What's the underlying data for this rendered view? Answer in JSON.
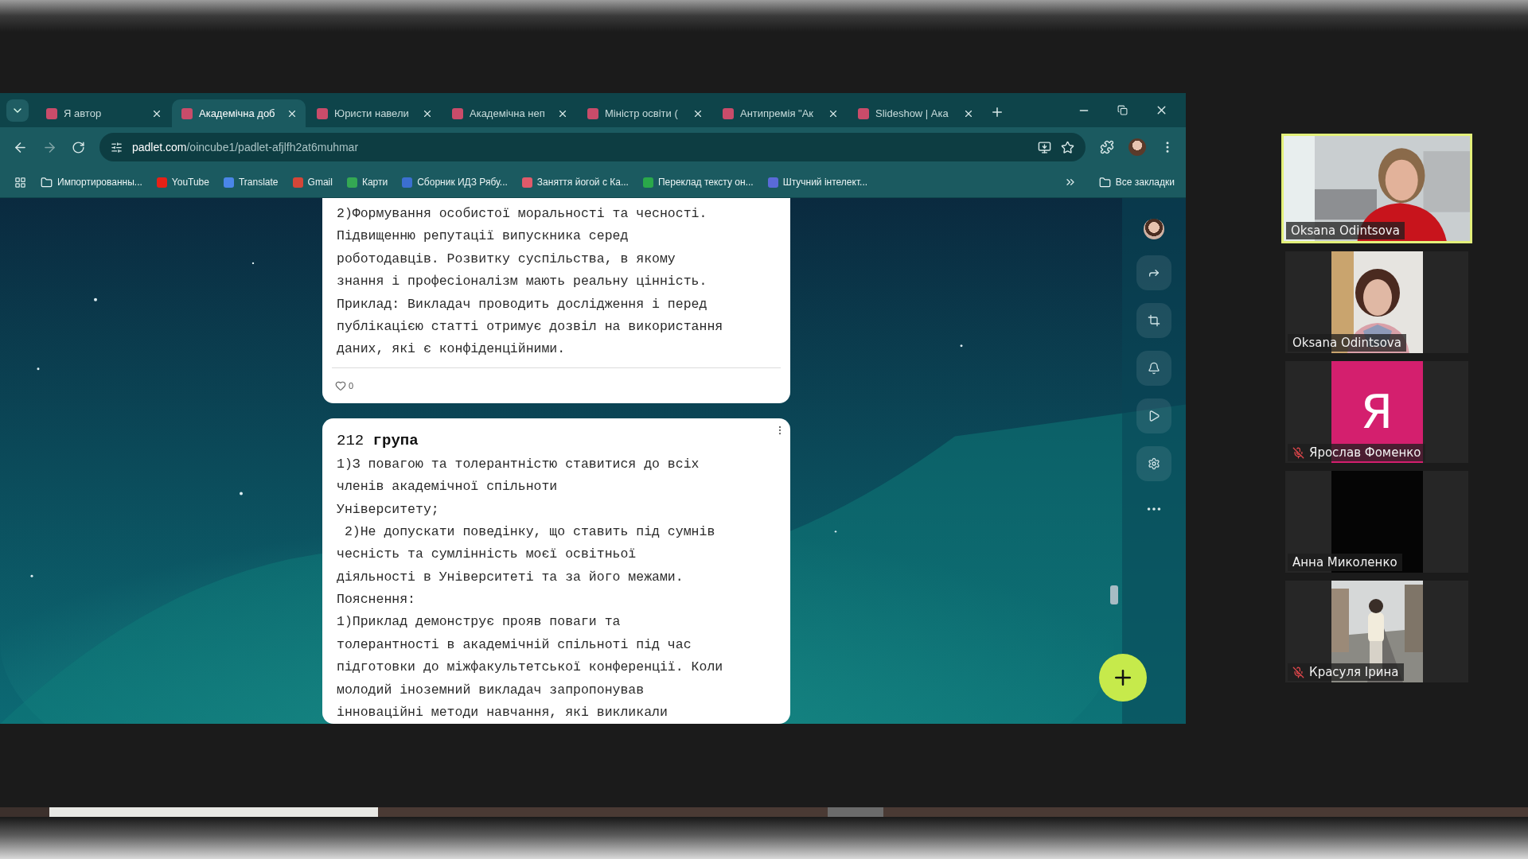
{
  "browser": {
    "tabs": [
      {
        "title": "Я автор",
        "selected": false
      },
      {
        "title": "Академічна доб",
        "selected": true
      },
      {
        "title": "Юристи навели",
        "selected": false
      },
      {
        "title": "Академічна неп",
        "selected": false
      },
      {
        "title": "Міністр освіти (",
        "selected": false
      },
      {
        "title": "Антипремія \"Ак",
        "selected": false
      },
      {
        "title": "Slideshow | Ака",
        "selected": false
      }
    ],
    "address": {
      "host": "padlet.com",
      "path": "/oincube1/padlet-afjlfh2at6muhmar"
    },
    "bookmarks": [
      {
        "label": "Импортированны...",
        "kind": "folder"
      },
      {
        "label": "YouTube",
        "kind": "link"
      },
      {
        "label": "Translate",
        "kind": "link"
      },
      {
        "label": "Gmail",
        "kind": "link"
      },
      {
        "label": "Карти",
        "kind": "link"
      },
      {
        "label": "Сборник ИДЗ Рябу...",
        "kind": "link"
      },
      {
        "label": "Заняття йогой с Ка...",
        "kind": "link"
      },
      {
        "label": "Переклад тексту он...",
        "kind": "link"
      },
      {
        "label": "Штучний інтелект...",
        "kind": "link"
      }
    ],
    "all_bookmarks": "Все закладки"
  },
  "padlet": {
    "posts": [
      {
        "lines": [
          "2)Формування особистої моральності та чесності.",
          "Підвищенню репутації випускника серед",
          "роботодавців. Розвитку суспільства, в якому",
          "знання і професіоналізм мають реальну цінність.",
          "Приклад: Викладач проводить дослідження і перед",
          "публікацією статті отримує дозвіл на використання",
          "даних, які є конфіденційними."
        ],
        "likes": "0"
      },
      {
        "title": "212 **група**",
        "lines": [
          "1)З повагою та толерантністю ставитися до всіх",
          "членів академічної спільноти",
          "Університету;",
          " 2)Не допускати поведінку, що ставить під сумнів",
          "чесність та сумлінність моєї освітньої",
          "діяльності в Університеті та за його межами.",
          "Пояснення:",
          "1)Приклад демонструє прояв поваги та",
          "толерантності в академічній спільноті під час",
          "підготовки до міжфакультетської конференції. Коли",
          "молодий іноземний викладач запропонував",
          "інноваційні методи навчання, які викликали"
        ]
      }
    ]
  },
  "participants": [
    {
      "name": "Oksana Odintsova",
      "kind": "video",
      "active": true,
      "muted": false
    },
    {
      "name": "Oksana Odintsova",
      "kind": "video",
      "active": false,
      "muted": false
    },
    {
      "name": "Ярослав Фоменко",
      "kind": "avatar",
      "initial": "Я",
      "color": "#d41f6e",
      "active": false,
      "muted": true
    },
    {
      "name": "Анна Миколенко",
      "kind": "camera-off",
      "active": false,
      "muted": false
    },
    {
      "name": "Красуля Ірина",
      "kind": "video",
      "active": false,
      "muted": true
    }
  ]
}
